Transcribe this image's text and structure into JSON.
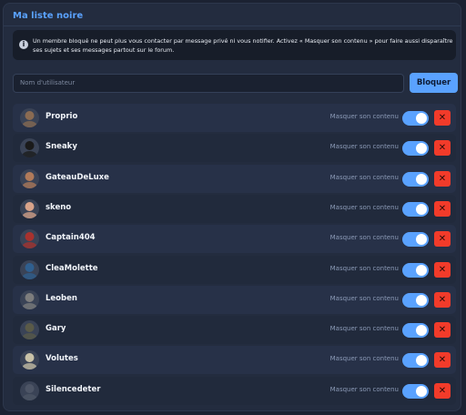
{
  "header": {
    "title": "Ma liste noire"
  },
  "info": {
    "icon": "info-icon",
    "text": "Un membre bloqué ne peut plus vous contacter par message privé ni vous notifier. Activez « Masquer son contenu » pour faire aussi disparaître ses sujets et ses messages partout sur le forum."
  },
  "search": {
    "placeholder": "Nom d'utilisateur",
    "button_label": "Bloquer"
  },
  "blocked_users": [
    {
      "name": "Proprio",
      "mask_label": "Masquer son contenu",
      "mask_enabled": true,
      "avatar_color": "#8a6b52",
      "remove_icon": "close-icon"
    },
    {
      "name": "Sneaky",
      "mask_label": "Masquer son contenu",
      "mask_enabled": true,
      "avatar_color": "#1a1a1a",
      "remove_icon": "close-icon"
    },
    {
      "name": "GateauDeLuxe",
      "mask_label": "Masquer son contenu",
      "mask_enabled": true,
      "avatar_color": "#b07a5a",
      "remove_icon": "close-icon"
    },
    {
      "name": "skeno",
      "mask_label": "Masquer son contenu",
      "mask_enabled": true,
      "avatar_color": "#d8a38a",
      "remove_icon": "close-icon"
    },
    {
      "name": "Captain404",
      "mask_label": "Masquer son contenu",
      "mask_enabled": true,
      "avatar_color": "#a8322e",
      "remove_icon": "close-icon"
    },
    {
      "name": "CleaMolette",
      "mask_label": "Masquer son contenu",
      "mask_enabled": true,
      "avatar_color": "#2f5f8f",
      "remove_icon": "close-icon"
    },
    {
      "name": "Leoben",
      "mask_label": "Masquer son contenu",
      "mask_enabled": true,
      "avatar_color": "#7d7d7d",
      "remove_icon": "close-icon"
    },
    {
      "name": "Gary",
      "mask_label": "Masquer son contenu",
      "mask_enabled": true,
      "avatar_color": "#5a5a48",
      "remove_icon": "close-icon"
    },
    {
      "name": "Volutes",
      "mask_label": "Masquer son contenu",
      "mask_enabled": true,
      "avatar_color": "#c9c2a8",
      "remove_icon": "close-icon"
    },
    {
      "name": "Silencedeter",
      "mask_label": "Masquer son contenu",
      "mask_enabled": true,
      "avatar_color": "#4d5566",
      "remove_icon": "close-icon"
    }
  ],
  "colors": {
    "accent": "#5aa2ff",
    "danger": "#f23b2a",
    "background": "#1b2232",
    "panel": "#232c3f"
  }
}
